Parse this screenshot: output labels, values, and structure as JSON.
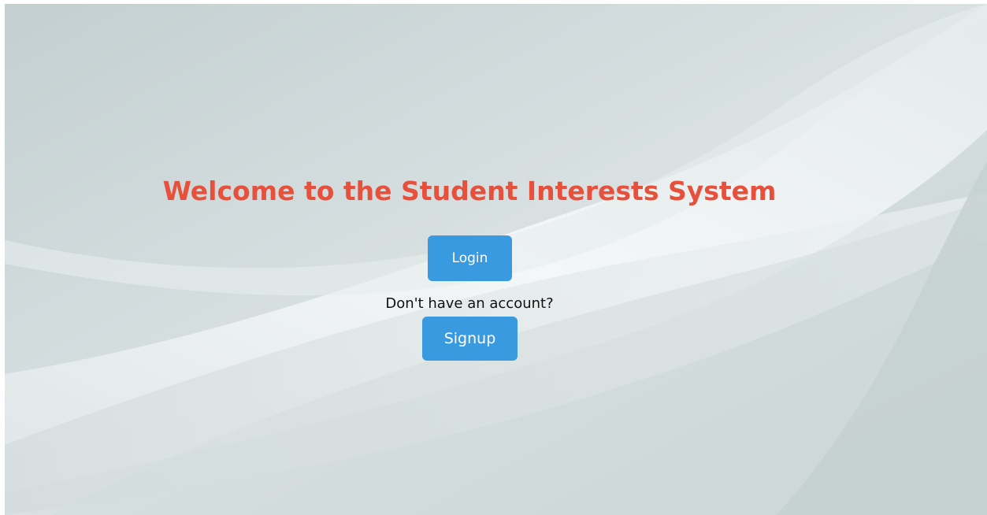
{
  "page": {
    "title": "Welcome to the Student Interests System",
    "login_label": "Login",
    "account_prompt": "Don't have an account?",
    "signup_label": "Signup"
  },
  "colors": {
    "title": "#e7503b",
    "button": "#3a9ae0",
    "button_text": "#ffffff",
    "background": "#c9d3d4"
  }
}
